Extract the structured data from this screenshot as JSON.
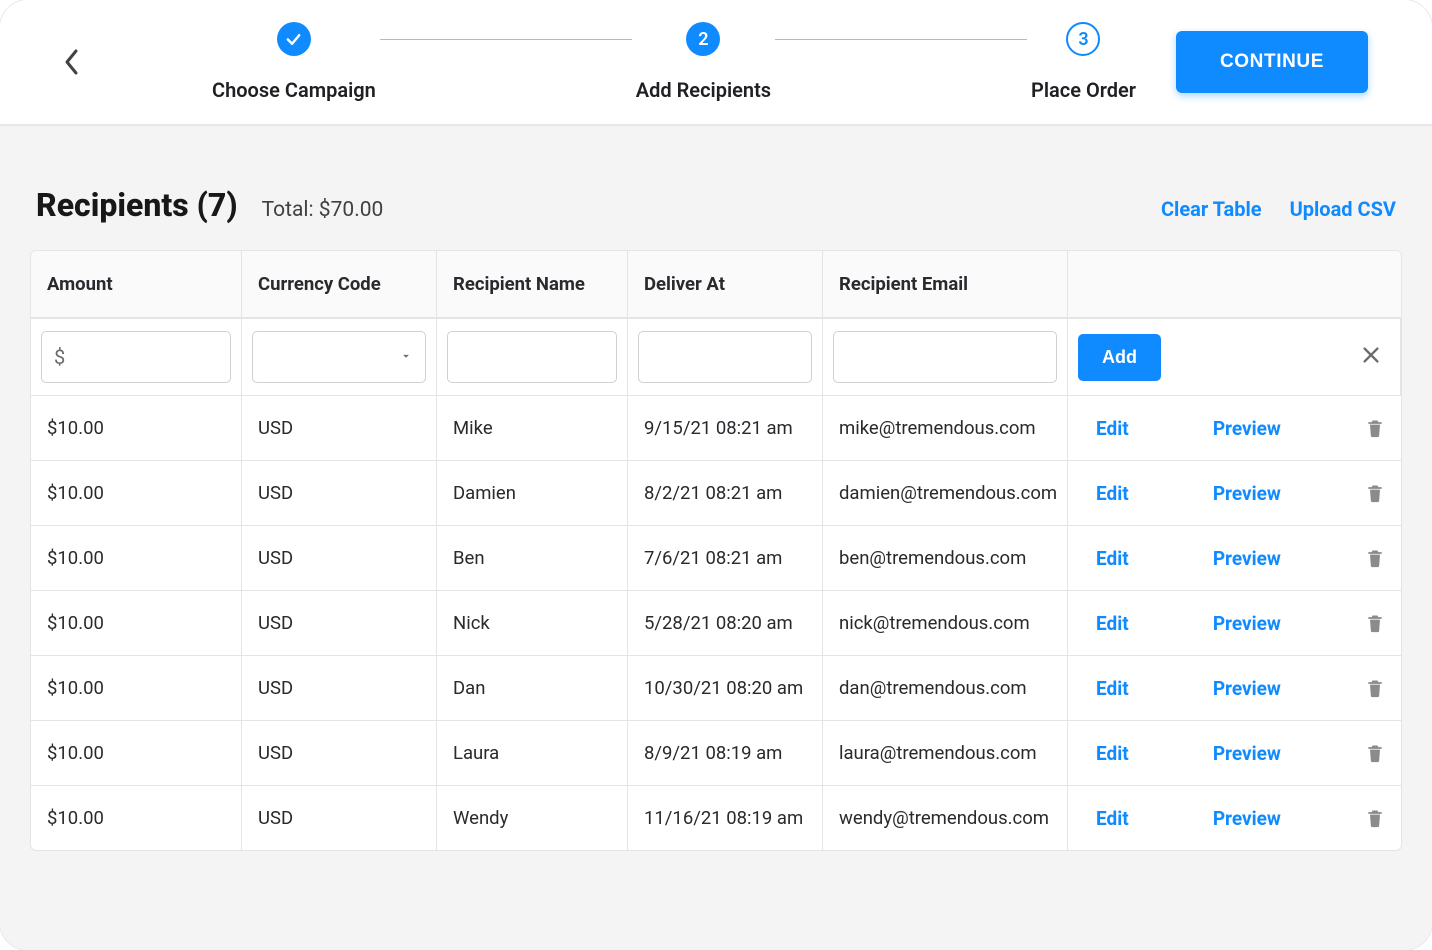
{
  "header": {
    "continue_label": "CONTINUE",
    "steps": [
      {
        "label": "Choose Campaign",
        "state": "done",
        "indicator": "check"
      },
      {
        "label": "Add Recipients",
        "state": "active",
        "indicator": "2"
      },
      {
        "label": "Place Order",
        "state": "pending",
        "indicator": "3"
      }
    ]
  },
  "page": {
    "title": "Recipients (7)",
    "subtitle": "Total: $70.00",
    "clear_table_label": "Clear Table",
    "upload_csv_label": "Upload CSV"
  },
  "table": {
    "columns": {
      "amount": "Amount",
      "currency": "Currency Code",
      "name": "Recipient Name",
      "deliver_at": "Deliver At",
      "email": "Recipient Email"
    },
    "input_row": {
      "amount_prefix": "$",
      "add_label": "Add"
    },
    "row_actions": {
      "edit": "Edit",
      "preview": "Preview"
    },
    "rows": [
      {
        "amount": "$10.00",
        "currency": "USD",
        "name": "Mike",
        "deliver_at": "9/15/21 08:21 am",
        "email": "mike@tremendous.com"
      },
      {
        "amount": "$10.00",
        "currency": "USD",
        "name": "Damien",
        "deliver_at": "8/2/21 08:21 am",
        "email": "damien@tremendous.com"
      },
      {
        "amount": "$10.00",
        "currency": "USD",
        "name": "Ben",
        "deliver_at": "7/6/21 08:21 am",
        "email": "ben@tremendous.com"
      },
      {
        "amount": "$10.00",
        "currency": "USD",
        "name": "Nick",
        "deliver_at": "5/28/21 08:20 am",
        "email": "nick@tremendous.com"
      },
      {
        "amount": "$10.00",
        "currency": "USD",
        "name": "Dan",
        "deliver_at": "10/30/21 08:20 am",
        "email": "dan@tremendous.com"
      },
      {
        "amount": "$10.00",
        "currency": "USD",
        "name": "Laura",
        "deliver_at": "8/9/21 08:19 am",
        "email": "laura@tremendous.com"
      },
      {
        "amount": "$10.00",
        "currency": "USD",
        "name": "Wendy",
        "deliver_at": "11/16/21 08:19 am",
        "email": "wendy@tremendous.com"
      }
    ]
  }
}
